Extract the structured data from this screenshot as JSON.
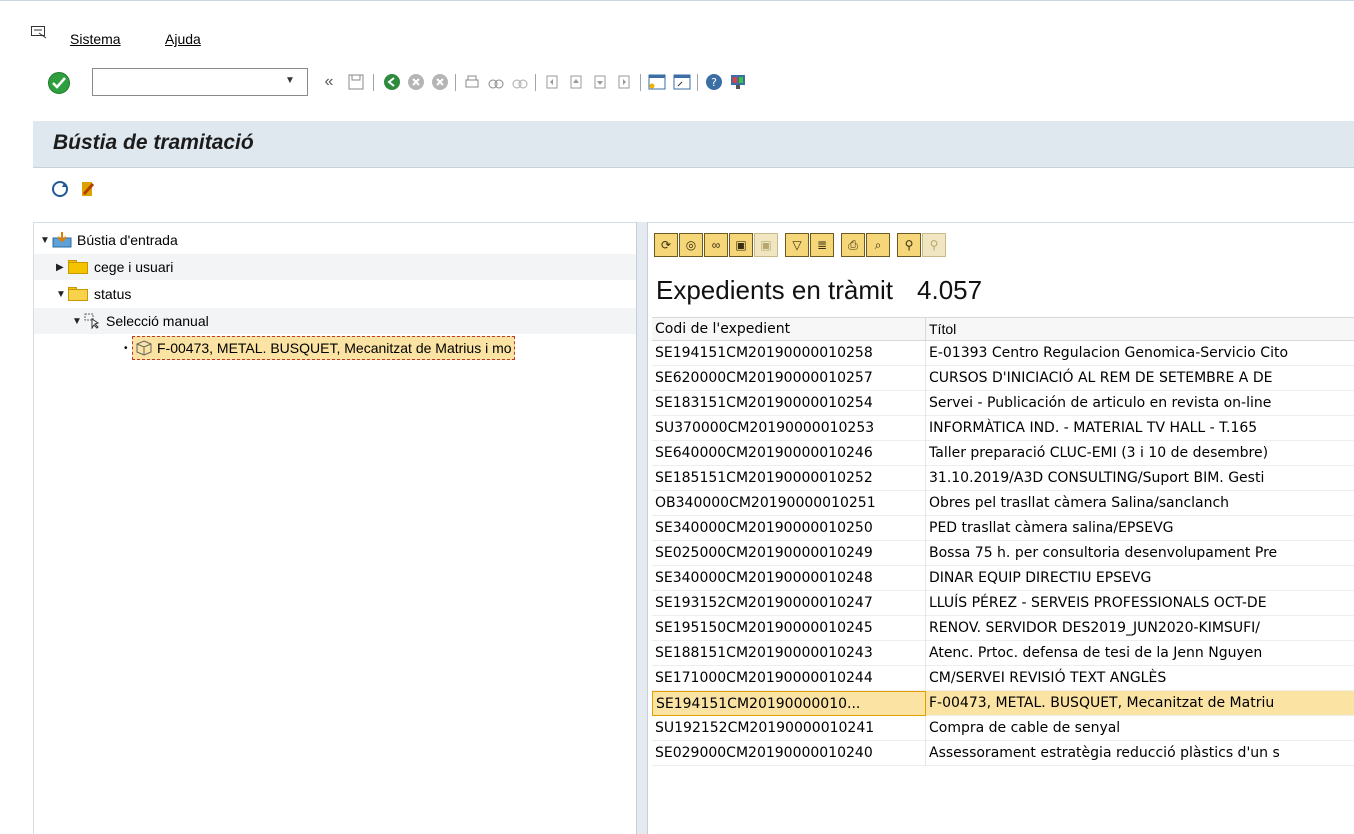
{
  "menu": {
    "sistema": "Sistema",
    "ajuda": "Ajuda"
  },
  "toolbar": {
    "command_value": "",
    "back_symbol": "«"
  },
  "page": {
    "title": "Bústia de tramitació"
  },
  "tree": {
    "root": "Bústia d'entrada",
    "folder1": "cege i usuari",
    "folder2": "status",
    "selection": "Selecció manual",
    "item": "F-00473, METAL. BUSQUET, Mecanitzat de Matrius i mo"
  },
  "grid": {
    "title": "Expedients en tràmit",
    "count": "4.057",
    "col_code": "Codi de l'expedient",
    "col_title": "Títol",
    "rows": [
      {
        "code": "SE194151CM20190000010258",
        "title": "E-01393 Centro Regulacion Genomica-Servicio Cito"
      },
      {
        "code": "SE620000CM20190000010257",
        "title": "CURSOS D'INICIACIÓ AL REM DE SETEMBRE A DE"
      },
      {
        "code": "SE183151CM20190000010254",
        "title": "Servei - Publicación de articulo en revista on-line"
      },
      {
        "code": "SU370000CM20190000010253",
        "title": "INFORMÀTICA IND. - MATERIAL TV HALL - T.165"
      },
      {
        "code": "SE640000CM20190000010246",
        "title": "Taller preparació CLUC-EMI (3 i 10 de desembre)"
      },
      {
        "code": "SE185151CM20190000010252",
        "title": "31.10.2019/A3D CONSULTING/Suport BIM. Gesti"
      },
      {
        "code": "OB340000CM20190000010251",
        "title": "Obres pel trasllat càmera Salina/sanclanch"
      },
      {
        "code": "SE340000CM20190000010250",
        "title": "PED trasllat càmera salina/EPSEVG"
      },
      {
        "code": "SE025000CM20190000010249",
        "title": "Bossa 75 h. per consultoria desenvolupament Pre"
      },
      {
        "code": "SE340000CM20190000010248",
        "title": "DINAR EQUIP DIRECTIU EPSEVG"
      },
      {
        "code": "SE193152CM20190000010247",
        "title": "LLUÍS PÉREZ - SERVEIS PROFESSIONALS OCT-DE"
      },
      {
        "code": "SE195150CM20190000010245",
        "title": "RENOV. SERVIDOR DES2019_JUN2020-KIMSUFI/"
      },
      {
        "code": "SE188151CM20190000010243",
        "title": "Atenc. Prtoc. defensa de tesi de la Jenn Nguyen"
      },
      {
        "code": "SE171000CM20190000010244",
        "title": "CM/SERVEI REVISIÓ TEXT ANGLÈS"
      },
      {
        "code": "SE194151CM20190000010...",
        "title": "F-00473, METAL. BUSQUET, Mecanitzat de Matriu"
      },
      {
        "code": "SU192152CM20190000010241",
        "title": "Compra de cable de senyal"
      },
      {
        "code": "SE029000CM20190000010240",
        "title": "Assessorament estratègia reducció plàstics d'un s"
      }
    ]
  },
  "colors": {
    "title_bar": "#dfe7ef",
    "highlight": "#fbe3a4",
    "ok_green": "#2e9e3e"
  }
}
